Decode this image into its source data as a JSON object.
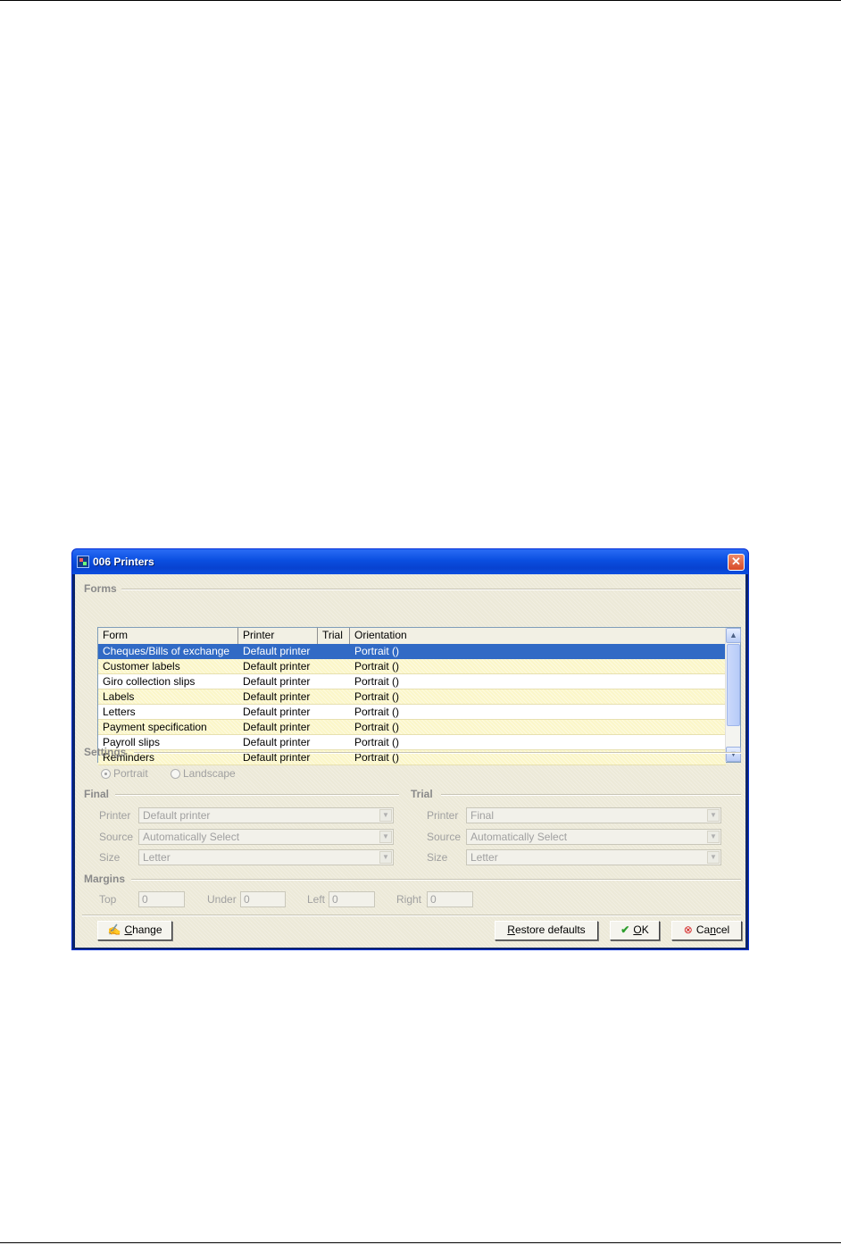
{
  "window": {
    "title": "006 Printers",
    "close_symbol": "✕"
  },
  "forms": {
    "group_label": "Forms",
    "columns": [
      "Form",
      "Printer",
      "Trial",
      "Orientation"
    ],
    "rows": [
      {
        "form": "Cheques/Bills of exchange",
        "printer": "Default printer",
        "trial": "",
        "orientation": "Portrait ()",
        "selected": true
      },
      {
        "form": "Customer labels",
        "printer": "Default printer",
        "trial": "",
        "orientation": "Portrait ()"
      },
      {
        "form": "Giro collection slips",
        "printer": "Default printer",
        "trial": "",
        "orientation": "Portrait ()"
      },
      {
        "form": "Labels",
        "printer": "Default printer",
        "trial": "",
        "orientation": "Portrait ()"
      },
      {
        "form": "Letters",
        "printer": "Default printer",
        "trial": "",
        "orientation": "Portrait ()"
      },
      {
        "form": "Payment specification",
        "printer": "Default printer",
        "trial": "",
        "orientation": "Portrait ()"
      },
      {
        "form": "Payroll slips",
        "printer": "Default printer",
        "trial": "",
        "orientation": "Portrait ()"
      },
      {
        "form": "Reminders",
        "printer": "Default printer",
        "trial": "",
        "orientation": "Portrait ()"
      }
    ]
  },
  "settings": {
    "group_label": "Settings",
    "portrait_label": "Portrait",
    "landscape_label": "Landscape",
    "selected": "portrait"
  },
  "final": {
    "group_label": "Final",
    "printer_label": "Printer",
    "printer_value": "Default printer",
    "source_label": "Source",
    "source_value": "Automatically Select",
    "size_label": "Size",
    "size_value": "Letter"
  },
  "trial": {
    "group_label": "Trial",
    "printer_label": "Printer",
    "printer_value": "Final",
    "source_label": "Source",
    "source_value": "Automatically Select",
    "size_label": "Size",
    "size_value": "Letter"
  },
  "margins": {
    "group_label": "Margins",
    "top_label": "Top",
    "top_value": "0",
    "under_label": "Under",
    "under_value": "0",
    "left_label": "Left",
    "left_value": "0",
    "right_label": "Right",
    "right_value": "0"
  },
  "buttons": {
    "change_first": "C",
    "change_rest": "hange",
    "restore_first": "R",
    "restore_rest": "estore defaults",
    "ok_first": "O",
    "ok_rest": "K",
    "cancel_pre": "Ca",
    "cancel_u": "n",
    "cancel_post": "cel"
  },
  "icons": {
    "change": "printer-edit-icon",
    "ok": "checkmark-icon",
    "cancel": "cancel-icon"
  },
  "colors": {
    "selection": "#316ac5",
    "titlebar": "#0a4ee0",
    "row_alt": "#fbf6c8"
  }
}
